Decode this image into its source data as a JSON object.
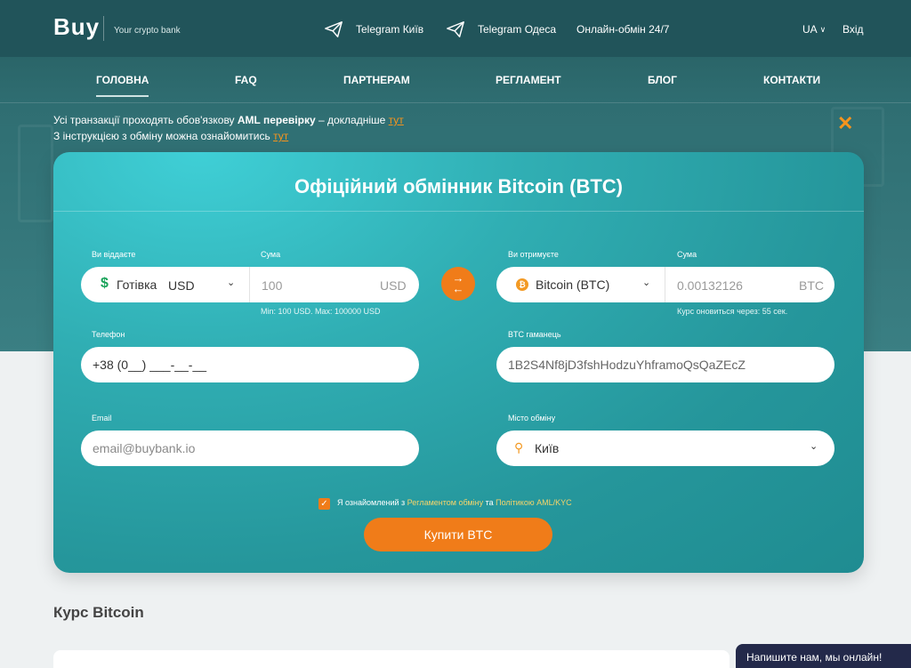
{
  "header": {
    "logo": "Buy",
    "tagline": "Your crypto bank",
    "telegram_kyiv": "Telegram Київ",
    "telegram_odesa": "Telegram Одеса",
    "online_exchange": "Онлайн-обмін 24/7",
    "language": "UA",
    "login": "Вхід"
  },
  "nav": {
    "items": [
      "ГОЛОВНА",
      "FAQ",
      "ПАРТНЕРАМ",
      "РЕГЛАМЕНТ",
      "БЛОГ",
      "КОНТАКТИ"
    ]
  },
  "notice": {
    "line1_prefix": "Усі транзакції проходять обов'язкову ",
    "line1_bold": "AML перевірку",
    "line1_suffix": " – докладніше ",
    "line1_link": "тут",
    "line2_prefix": "З інструкцією з обміну можна ознайомитись ",
    "line2_link": "тут"
  },
  "exchange": {
    "title": "Офіційний обмінник Bitcoin (BTC)",
    "give_label": "Ви віддаєте",
    "give_method": "Готівка",
    "give_currency": "USD",
    "give_sum_label": "Сума",
    "give_sum_value": "100",
    "give_sum_currency": "USD",
    "give_limits": "Min: 100 USD. Max: 100000 USD",
    "receive_label": "Ви отримуєте",
    "receive_currency": "Bitcoin (BTC)",
    "receive_sum_label": "Сума",
    "receive_sum_value": "0.00132126",
    "receive_sum_currency": "BTC",
    "rate_update": "Курс оновиться через: 55 сек.",
    "phone_label": "Телефон",
    "phone_value": "+38 (0__) ___-__-__",
    "wallet_label": "BTC гаманець",
    "wallet_value": "1B2S4Nf8jD3fshHodzuYhframoQsQaZEcZ",
    "email_label": "Email",
    "email_placeholder": "email@buybank.io",
    "city_label": "Місто обміну",
    "city_value": "Київ",
    "agree_prefix": "Я ознайомлений з ",
    "agree_link1": "Регламентом обміну",
    "agree_mid": " та ",
    "agree_link2": "Політикою AML/KYC",
    "agree_checked": true,
    "buy_button": "Купити BTC"
  },
  "rate_section": {
    "title": "Курс Bitcoin"
  },
  "chat": {
    "label": "Напишите нам, мы онлайн!"
  },
  "colors": {
    "accent": "#f07c19",
    "header": "#21545a",
    "card": "#30aeb3"
  }
}
